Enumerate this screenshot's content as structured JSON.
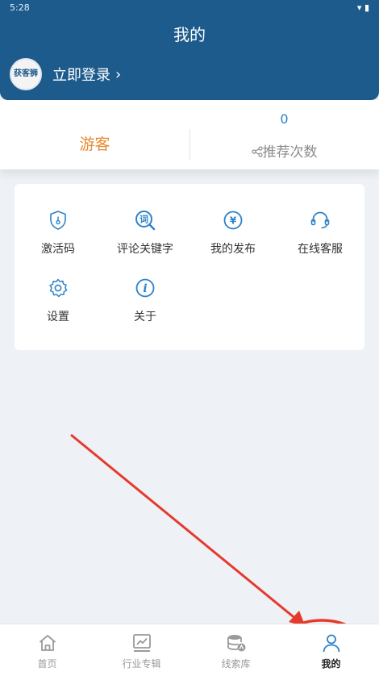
{
  "status_bar": {
    "time": "5:28"
  },
  "header": {
    "title": "我的",
    "login_text": "立即登录",
    "login_chevron": "›",
    "avatar_text": "获客狮"
  },
  "stats": {
    "role": "游客",
    "recommend_count": "0",
    "recommend_label": "推荐次数"
  },
  "menu": {
    "items": [
      {
        "label": "激活码",
        "icon": "shield-key-icon"
      },
      {
        "label": "评论关键字",
        "icon": "keyword-search-icon"
      },
      {
        "label": "我的发布",
        "icon": "yuan-icon"
      },
      {
        "label": "在线客服",
        "icon": "headset-icon"
      },
      {
        "label": "设置",
        "icon": "gear-icon"
      },
      {
        "label": "关于",
        "icon": "info-icon"
      }
    ]
  },
  "tabbar": {
    "items": [
      {
        "label": "首页",
        "icon": "home-icon"
      },
      {
        "label": "行业专辑",
        "icon": "chart-board-icon"
      },
      {
        "label": "线索库",
        "icon": "database-icon"
      },
      {
        "label": "我的",
        "icon": "person-icon"
      }
    ],
    "active_index": 3
  },
  "colors": {
    "header": "#1e5b8d",
    "accent": "#2c82c9",
    "guest": "#e8892f",
    "annotation": "#e53b2c"
  }
}
